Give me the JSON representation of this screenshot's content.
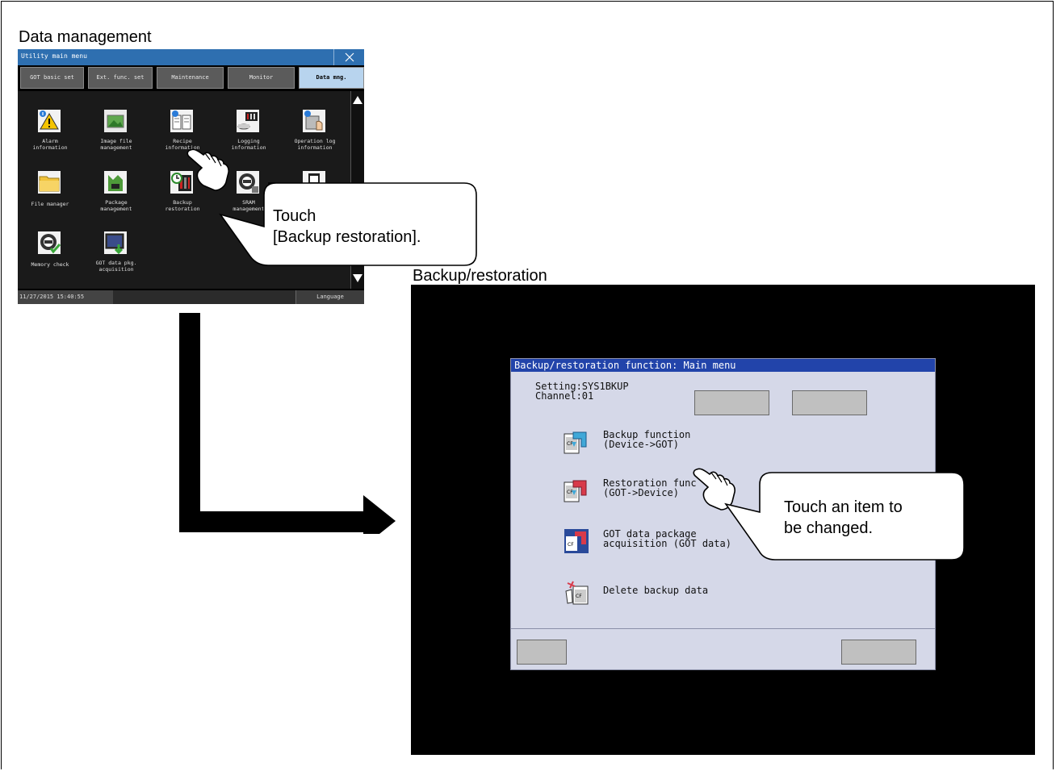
{
  "captions": {
    "data_management": "Data management",
    "backup_restoration": "Backup/restoration"
  },
  "utility_screen": {
    "title": "Utility main menu",
    "tabs": [
      {
        "label": "GOT basic set",
        "active": false
      },
      {
        "label": "Ext. func. set",
        "active": false
      },
      {
        "label": "Maintenance",
        "active": false
      },
      {
        "label": "Monitor",
        "active": false
      },
      {
        "label": "Data mng.",
        "active": true
      }
    ],
    "items": [
      {
        "label": "Alarm\ninformation",
        "icon": "alarm-info-icon"
      },
      {
        "label": "Image file\nmanagement",
        "icon": "image-file-icon"
      },
      {
        "label": "Recipe\ninformation",
        "icon": "recipe-info-icon"
      },
      {
        "label": "Logging\ninformation",
        "icon": "logging-info-icon"
      },
      {
        "label": "Operation log\ninformation",
        "icon": "operation-log-icon"
      },
      {
        "label": "File manager",
        "icon": "file-manager-icon"
      },
      {
        "label": "Package\nmanagement",
        "icon": "package-management-icon"
      },
      {
        "label": "Backup\nrestoration",
        "icon": "backup-restoration-icon"
      },
      {
        "label": "SRAM\nmanagement",
        "icon": "sram-icon"
      },
      {
        "label": "",
        "icon": "unknown-item-icon"
      },
      {
        "label": "Memory check",
        "icon": "memory-check-icon"
      },
      {
        "label": "GOT data pkg.\nacquisition",
        "icon": "got-data-pkg-icon"
      }
    ],
    "status_time": "11/27/2015 15:40:55",
    "language_button": "Language"
  },
  "callouts": {
    "first_line1": "Touch",
    "first_line2": "[Backup restoration].",
    "second_line1": "Touch an item to",
    "second_line2": "be changed."
  },
  "backup_screen": {
    "title": "Backup/restoration function: Main menu",
    "setting_line": "Setting:SYS1BKUP",
    "channel_line": "Channel:01",
    "items": [
      {
        "line1": "Backup function",
        "line2": "(Device->GOT)",
        "icon": "backup-function-icon"
      },
      {
        "line1": "Restoration func",
        "line2": "(GOT->Device)",
        "icon": "restoration-function-icon"
      },
      {
        "line1": "GOT data package",
        "line2": "acquisition (GOT data)",
        "icon": "got-data-package-icon"
      },
      {
        "line1": "Delete backup data",
        "line2": "",
        "icon": "delete-backup-icon"
      }
    ]
  }
}
